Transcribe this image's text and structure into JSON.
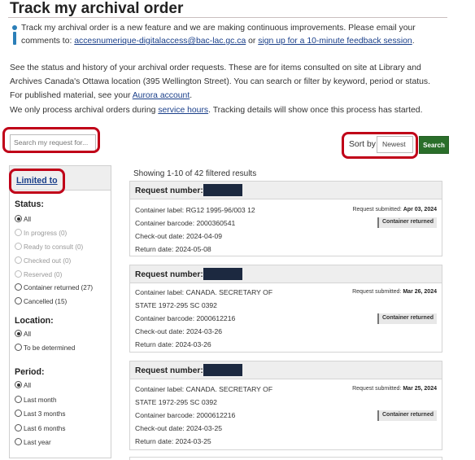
{
  "page": {
    "title": "Track my archival order",
    "notice": {
      "text_before": "Track my archival order is a new feature and we are making continuous improvements. Please email your comments to: ",
      "email": "accesnumerique-digitalaccess@bac-lac.gc.ca",
      "text_middle": " or ",
      "feedback_link": "sign up for a 10-minute feedback session",
      "text_after": "."
    },
    "intro": {
      "text": "See the status and history of your archival order requests. These are for items consulted on site at Library and Archives Canada's Ottawa location (395 Wellington Street). You can search or filter by keyword, period or status. For published material, see your ",
      "aurora_link": "Aurora account",
      "text_end": "."
    },
    "hours": {
      "text_before": "We only process archival orders during ",
      "service_link": "service hours",
      "text_after": ". Tracking details will show once this process has started."
    }
  },
  "search": {
    "placeholder": "Search my request for...",
    "sort_label": "Sort by",
    "sort_value": "Newest",
    "button_label": "Search"
  },
  "filters": {
    "heading": "Limited to",
    "status": {
      "label": "Status:",
      "options": [
        "All",
        "In progress (0)",
        "Ready to consult (0)",
        "Checked out (0)",
        "Reserved (0)",
        "Container returned (27)",
        "Cancelled (15)"
      ]
    },
    "location": {
      "label": "Location:",
      "options": [
        "All",
        "To be determined"
      ]
    },
    "period": {
      "label": "Period:",
      "options": [
        "All",
        "Last month",
        "Last 3 months",
        "Last 6 months",
        "Last year"
      ]
    }
  },
  "results": {
    "summary": "Showing 1-10 of 42 filtered results",
    "request_label": "Request number:",
    "submitted_label": "Request submitted:",
    "items": [
      {
        "container_label_1": "Container label: RG12 1995-96/003 12",
        "container_label_2": "",
        "barcode": "Container barcode: 2000360541",
        "checkout": "Check-out date: 2024-04-09",
        "return": "Return date: 2024-05-08",
        "submitted_date": "Apr 03, 2024",
        "status": "Container returned"
      },
      {
        "container_label_1": "Container label: CANADA. SECRETARY OF",
        "container_label_2": "STATE 1972-295 SC 0392",
        "barcode": "Container barcode: 2000612216",
        "checkout": "Check-out date: 2024-03-26",
        "return": "Return date: 2024-03-26",
        "submitted_date": "Mar 26, 2024",
        "status": "Container returned"
      },
      {
        "container_label_1": "Container label: CANADA. SECRETARY OF",
        "container_label_2": "STATE 1972-295 SC 0392",
        "barcode": "Container barcode: 2000612216",
        "checkout": "Check-out date: 2024-03-25",
        "return": "Return date: 2024-03-25",
        "submitted_date": "Mar 25, 2024",
        "status": "Container returned"
      }
    ]
  },
  "colors": {
    "accent_green": "#2a6e2a",
    "highlight_red": "#c00018",
    "link_blue": "#1a3f8a",
    "redaction": "#1c2940"
  },
  "icons": {
    "notice": "info-icon"
  }
}
